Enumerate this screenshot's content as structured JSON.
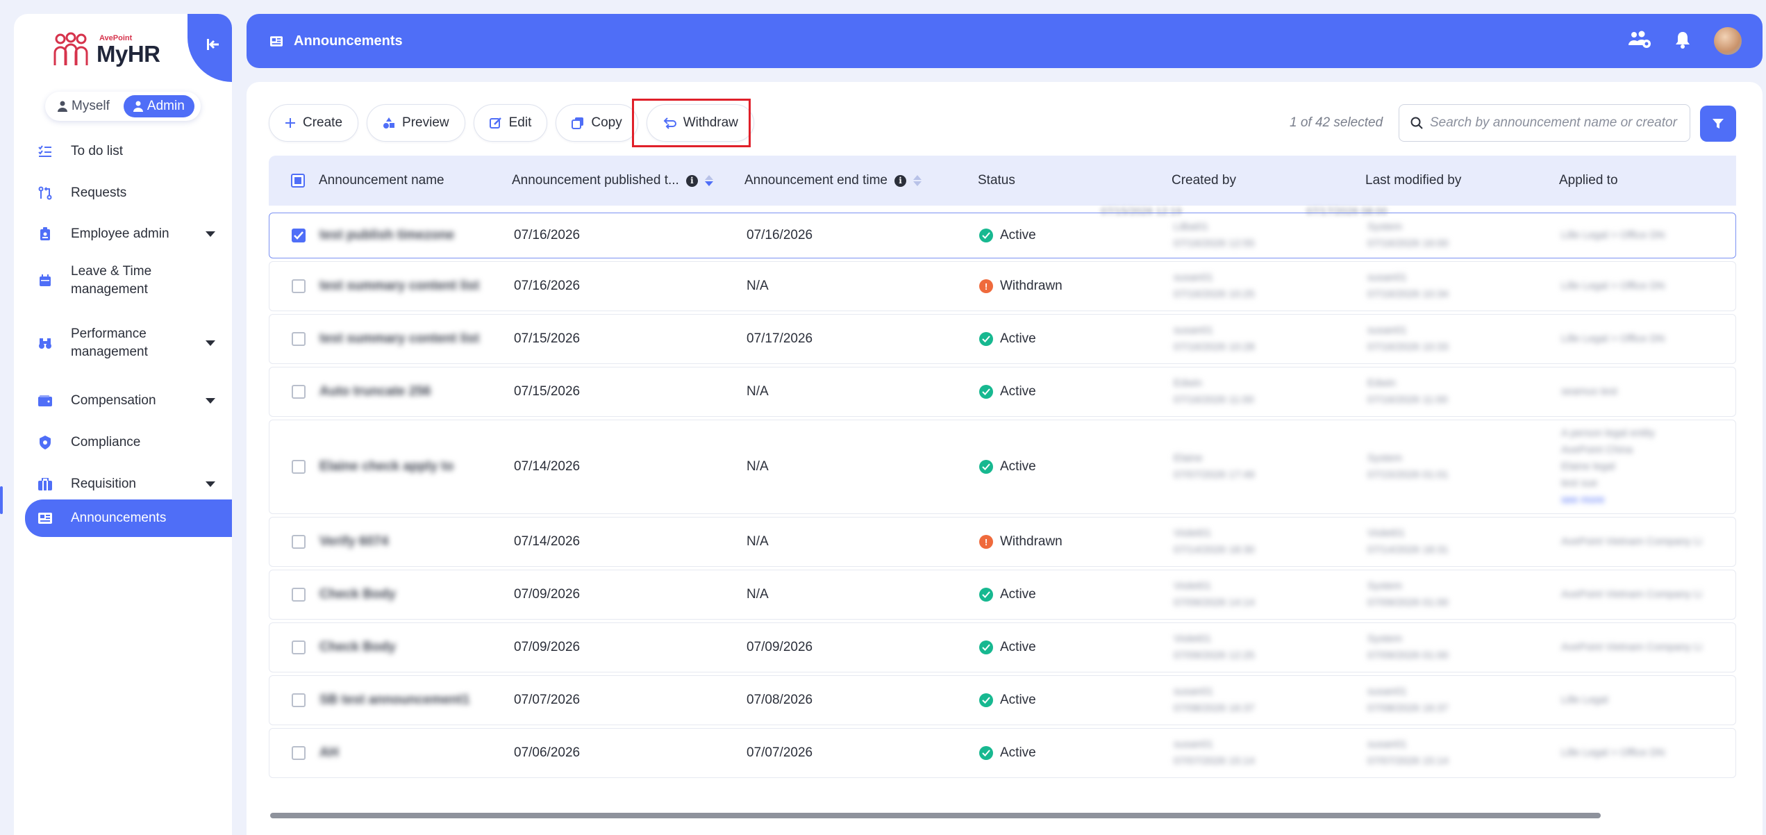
{
  "brand": {
    "small": "AvePoint",
    "name": "MyHR"
  },
  "mode_switch": {
    "myself": "Myself",
    "admin": "Admin"
  },
  "nav": [
    {
      "label": "To do list",
      "icon": "list-check-icon",
      "caret": false
    },
    {
      "label": "Requests",
      "icon": "requests-icon",
      "caret": false
    },
    {
      "label": "Employee admin",
      "icon": "badge-icon",
      "caret": true
    },
    {
      "label": "Leave & Time management",
      "icon": "calendar-icon",
      "caret": false
    },
    {
      "label": "Performance management",
      "icon": "binoculars-icon",
      "caret": true
    },
    {
      "label": "Compensation",
      "icon": "wallet-icon",
      "caret": true
    },
    {
      "label": "Compliance",
      "icon": "shield-icon",
      "caret": false
    },
    {
      "label": "Requisition",
      "icon": "briefcase-icon",
      "caret": true
    },
    {
      "label": "Announcements",
      "icon": "announcement-icon",
      "caret": false,
      "active": true
    }
  ],
  "header": {
    "title": "Announcements"
  },
  "toolbar": {
    "create": "Create",
    "preview": "Preview",
    "edit": "Edit",
    "copy": "Copy",
    "withdraw": "Withdraw"
  },
  "selection": {
    "text": "1 of 42 selected"
  },
  "search": {
    "placeholder": "Search by announcement name or creator"
  },
  "table": {
    "columns": {
      "name": "Announcement name",
      "published": "Announcement published t...",
      "end": "Announcement end time",
      "status": "Status",
      "created_by": "Created by",
      "modified_by": "Last modified by",
      "applied_to": "Applied to"
    },
    "rows": [
      {
        "name": "test publish timezone",
        "published": "07/16/2026",
        "end": "07/16/2026",
        "status": "Active",
        "created_by": "LiBai01",
        "created_at": "07/16/2026 12:55",
        "modified_by": "System",
        "modified_at": "07/16/2026 16:00",
        "applied_to": [
          "Lille Legal > Office DN"
        ],
        "checked": true
      },
      {
        "name": "test summary content list",
        "published": "07/16/2026",
        "end": "N/A",
        "status": "Withdrawn",
        "created_by": "susan01",
        "created_at": "07/16/2026 10:25",
        "modified_by": "susan01",
        "modified_at": "07/16/2026 10:34",
        "applied_to": [
          "Lille Legal > Office DN"
        ],
        "checked": false
      },
      {
        "name": "test summary content list",
        "published": "07/15/2026",
        "end": "07/17/2026",
        "status": "Active",
        "created_by": "susan01",
        "created_at": "07/16/2026 10:28",
        "modified_by": "susan01",
        "modified_at": "07/16/2026 10:33",
        "applied_to": [
          "Lille Legal > Office DN"
        ],
        "checked": false
      },
      {
        "name": "Auto truncate 256",
        "published": "07/15/2026",
        "end": "N/A",
        "status": "Active",
        "created_by": "Edwin",
        "created_at": "07/16/2026 11:00",
        "modified_by": "Edwin",
        "modified_at": "07/16/2026 11:00",
        "applied_to": [
          "seamus test"
        ],
        "checked": false
      },
      {
        "name": "Elaine check apply to",
        "published": "07/14/2026",
        "end": "N/A",
        "status": "Active",
        "created_by": "Elaine",
        "created_at": "07/07/2026 17:49",
        "modified_by": "System",
        "modified_at": "07/15/2026 01:01",
        "applied_to": [
          "A person legal entity",
          "AvePoint China",
          "Elaine legal",
          "test sue",
          "see more"
        ],
        "checked": false
      },
      {
        "name": "Verify 6074",
        "published": "07/14/2026",
        "end": "N/A",
        "status": "Withdrawn",
        "created_by": "Violet01",
        "created_at": "07/14/2026 18:30",
        "modified_by": "Violet01",
        "modified_at": "07/14/2026 18:31",
        "applied_to": [
          "AvePoint Vietnam Company Li"
        ],
        "checked": false
      },
      {
        "name": "Check Body",
        "published": "07/09/2026",
        "end": "N/A",
        "status": "Active",
        "created_by": "Violet01",
        "created_at": "07/09/2026 14:14",
        "modified_by": "System",
        "modified_at": "07/09/2026 01:00",
        "applied_to": [
          "AvePoint Vietnam Company Li"
        ],
        "checked": false
      },
      {
        "name": "Check Body",
        "published": "07/09/2026",
        "end": "07/09/2026",
        "status": "Active",
        "created_by": "Violet01",
        "created_at": "07/09/2026 12:25",
        "modified_by": "System",
        "modified_at": "07/09/2026 01:00",
        "applied_to": [
          "AvePoint Vietnam Company Li"
        ],
        "checked": false
      },
      {
        "name": "SB test announcement1",
        "published": "07/07/2026",
        "end": "07/08/2026",
        "status": "Active",
        "created_by": "susan01",
        "created_at": "07/08/2026 16:37",
        "modified_by": "susan01",
        "modified_at": "07/08/2026 16:37",
        "applied_to": [
          "Lille Legal"
        ],
        "checked": false
      },
      {
        "name": "AH",
        "published": "07/06/2026",
        "end": "07/07/2026",
        "status": "Active",
        "created_by": "susan01",
        "created_at": "07/07/2026 15:14",
        "modified_by": "susan01",
        "modified_at": "07/07/2026 15:14",
        "applied_to": [
          "Lille Legal > Office DN"
        ],
        "checked": false
      }
    ],
    "partial_top": {
      "created_at": "07/15/2026 12:19",
      "modified_at": "07/17/2026 08:00"
    }
  },
  "colors": {
    "accent": "#4f6ef7",
    "active": "#17b890",
    "withdrawn": "#ef6a3c",
    "highlight": "#e0202a"
  }
}
